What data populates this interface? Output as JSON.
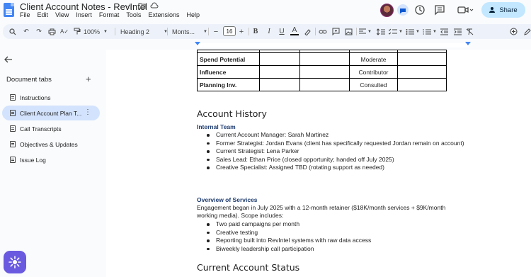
{
  "app": {
    "doc_title": "Client Account Notes - RevIntel",
    "menu": [
      "File",
      "Edit",
      "View",
      "Insert",
      "Format",
      "Tools",
      "Extensions",
      "Help"
    ],
    "share_label": "Share"
  },
  "toolbar": {
    "zoom": "100%",
    "style": "Heading 2",
    "font": "Monts...",
    "font_size": "16",
    "minus": "−",
    "plus": "+"
  },
  "sidebar": {
    "heading": "Document tabs",
    "tabs": [
      {
        "label": "Instructions"
      },
      {
        "label": "Client Account Plan T..."
      },
      {
        "label": "Call Transcripts"
      },
      {
        "label": "Objectives & Updates"
      },
      {
        "label": "Issue Log"
      }
    ]
  },
  "document": {
    "table_rows": [
      {
        "name": "Spend Potential",
        "value": "Moderate"
      },
      {
        "name": "Influence",
        "value": "Contributor"
      },
      {
        "name": "Planning Inv.",
        "value": "Consulted"
      }
    ],
    "account_history_heading": "Account History",
    "internal_team_heading": "Internal Team",
    "internal_team": [
      "Current Account Manager: Sarah Martinez",
      "Former Strategist: Jordan Evans (client has specifically requested Jordan remain on account)",
      "Current Strategist: Lena Parker",
      "Sales Lead: Ethan Price (closed opportunity; handed off July 2025)",
      "Creative Specialist: Assigned TBD (rotating support as needed)"
    ],
    "services_heading": "Overview of Services",
    "services_intro": "Engagement began in July 2025 with a 12-month retainer ($18K/month services + $9K/month working media). Scope includes:",
    "services": [
      "Two paid campaigns per month",
      "Creative testing",
      "Reporting built into RevIntel systems with raw data access",
      "Biweekly leadership call participation"
    ],
    "status_heading": "Current Account Status"
  },
  "colors": {
    "accent": "#0b57d0",
    "share_bg": "#c2e7ff",
    "active_tab_bg": "#d3e3fd",
    "subheading": "#1c3a6e"
  }
}
